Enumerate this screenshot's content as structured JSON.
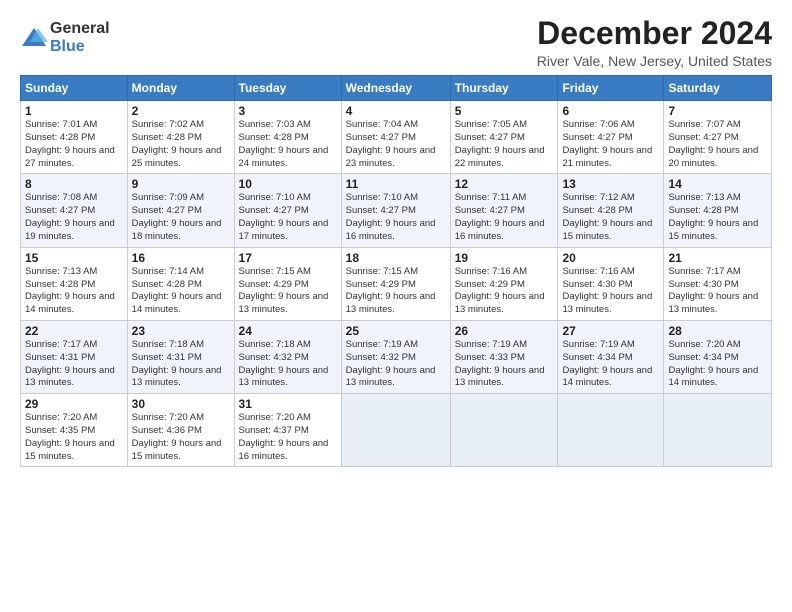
{
  "logo": {
    "general": "General",
    "blue": "Blue"
  },
  "title": "December 2024",
  "subtitle": "River Vale, New Jersey, United States",
  "days_header": [
    "Sunday",
    "Monday",
    "Tuesday",
    "Wednesday",
    "Thursday",
    "Friday",
    "Saturday"
  ],
  "weeks": [
    [
      {
        "day": "1",
        "sunrise": "7:01 AM",
        "sunset": "4:28 PM",
        "daylight": "9 hours and 27 minutes."
      },
      {
        "day": "2",
        "sunrise": "7:02 AM",
        "sunset": "4:28 PM",
        "daylight": "9 hours and 25 minutes."
      },
      {
        "day": "3",
        "sunrise": "7:03 AM",
        "sunset": "4:28 PM",
        "daylight": "9 hours and 24 minutes."
      },
      {
        "day": "4",
        "sunrise": "7:04 AM",
        "sunset": "4:27 PM",
        "daylight": "9 hours and 23 minutes."
      },
      {
        "day": "5",
        "sunrise": "7:05 AM",
        "sunset": "4:27 PM",
        "daylight": "9 hours and 22 minutes."
      },
      {
        "day": "6",
        "sunrise": "7:06 AM",
        "sunset": "4:27 PM",
        "daylight": "9 hours and 21 minutes."
      },
      {
        "day": "7",
        "sunrise": "7:07 AM",
        "sunset": "4:27 PM",
        "daylight": "9 hours and 20 minutes."
      }
    ],
    [
      {
        "day": "8",
        "sunrise": "7:08 AM",
        "sunset": "4:27 PM",
        "daylight": "9 hours and 19 minutes."
      },
      {
        "day": "9",
        "sunrise": "7:09 AM",
        "sunset": "4:27 PM",
        "daylight": "9 hours and 18 minutes."
      },
      {
        "day": "10",
        "sunrise": "7:10 AM",
        "sunset": "4:27 PM",
        "daylight": "9 hours and 17 minutes."
      },
      {
        "day": "11",
        "sunrise": "7:10 AM",
        "sunset": "4:27 PM",
        "daylight": "9 hours and 16 minutes."
      },
      {
        "day": "12",
        "sunrise": "7:11 AM",
        "sunset": "4:27 PM",
        "daylight": "9 hours and 16 minutes."
      },
      {
        "day": "13",
        "sunrise": "7:12 AM",
        "sunset": "4:28 PM",
        "daylight": "9 hours and 15 minutes."
      },
      {
        "day": "14",
        "sunrise": "7:13 AM",
        "sunset": "4:28 PM",
        "daylight": "9 hours and 15 minutes."
      }
    ],
    [
      {
        "day": "15",
        "sunrise": "7:13 AM",
        "sunset": "4:28 PM",
        "daylight": "9 hours and 14 minutes."
      },
      {
        "day": "16",
        "sunrise": "7:14 AM",
        "sunset": "4:28 PM",
        "daylight": "9 hours and 14 minutes."
      },
      {
        "day": "17",
        "sunrise": "7:15 AM",
        "sunset": "4:29 PM",
        "daylight": "9 hours and 13 minutes."
      },
      {
        "day": "18",
        "sunrise": "7:15 AM",
        "sunset": "4:29 PM",
        "daylight": "9 hours and 13 minutes."
      },
      {
        "day": "19",
        "sunrise": "7:16 AM",
        "sunset": "4:29 PM",
        "daylight": "9 hours and 13 minutes."
      },
      {
        "day": "20",
        "sunrise": "7:16 AM",
        "sunset": "4:30 PM",
        "daylight": "9 hours and 13 minutes."
      },
      {
        "day": "21",
        "sunrise": "7:17 AM",
        "sunset": "4:30 PM",
        "daylight": "9 hours and 13 minutes."
      }
    ],
    [
      {
        "day": "22",
        "sunrise": "7:17 AM",
        "sunset": "4:31 PM",
        "daylight": "9 hours and 13 minutes."
      },
      {
        "day": "23",
        "sunrise": "7:18 AM",
        "sunset": "4:31 PM",
        "daylight": "9 hours and 13 minutes."
      },
      {
        "day": "24",
        "sunrise": "7:18 AM",
        "sunset": "4:32 PM",
        "daylight": "9 hours and 13 minutes."
      },
      {
        "day": "25",
        "sunrise": "7:19 AM",
        "sunset": "4:32 PM",
        "daylight": "9 hours and 13 minutes."
      },
      {
        "day": "26",
        "sunrise": "7:19 AM",
        "sunset": "4:33 PM",
        "daylight": "9 hours and 13 minutes."
      },
      {
        "day": "27",
        "sunrise": "7:19 AM",
        "sunset": "4:34 PM",
        "daylight": "9 hours and 14 minutes."
      },
      {
        "day": "28",
        "sunrise": "7:20 AM",
        "sunset": "4:34 PM",
        "daylight": "9 hours and 14 minutes."
      }
    ],
    [
      {
        "day": "29",
        "sunrise": "7:20 AM",
        "sunset": "4:35 PM",
        "daylight": "9 hours and 15 minutes."
      },
      {
        "day": "30",
        "sunrise": "7:20 AM",
        "sunset": "4:36 PM",
        "daylight": "9 hours and 15 minutes."
      },
      {
        "day": "31",
        "sunrise": "7:20 AM",
        "sunset": "4:37 PM",
        "daylight": "9 hours and 16 minutes."
      },
      null,
      null,
      null,
      null
    ]
  ]
}
